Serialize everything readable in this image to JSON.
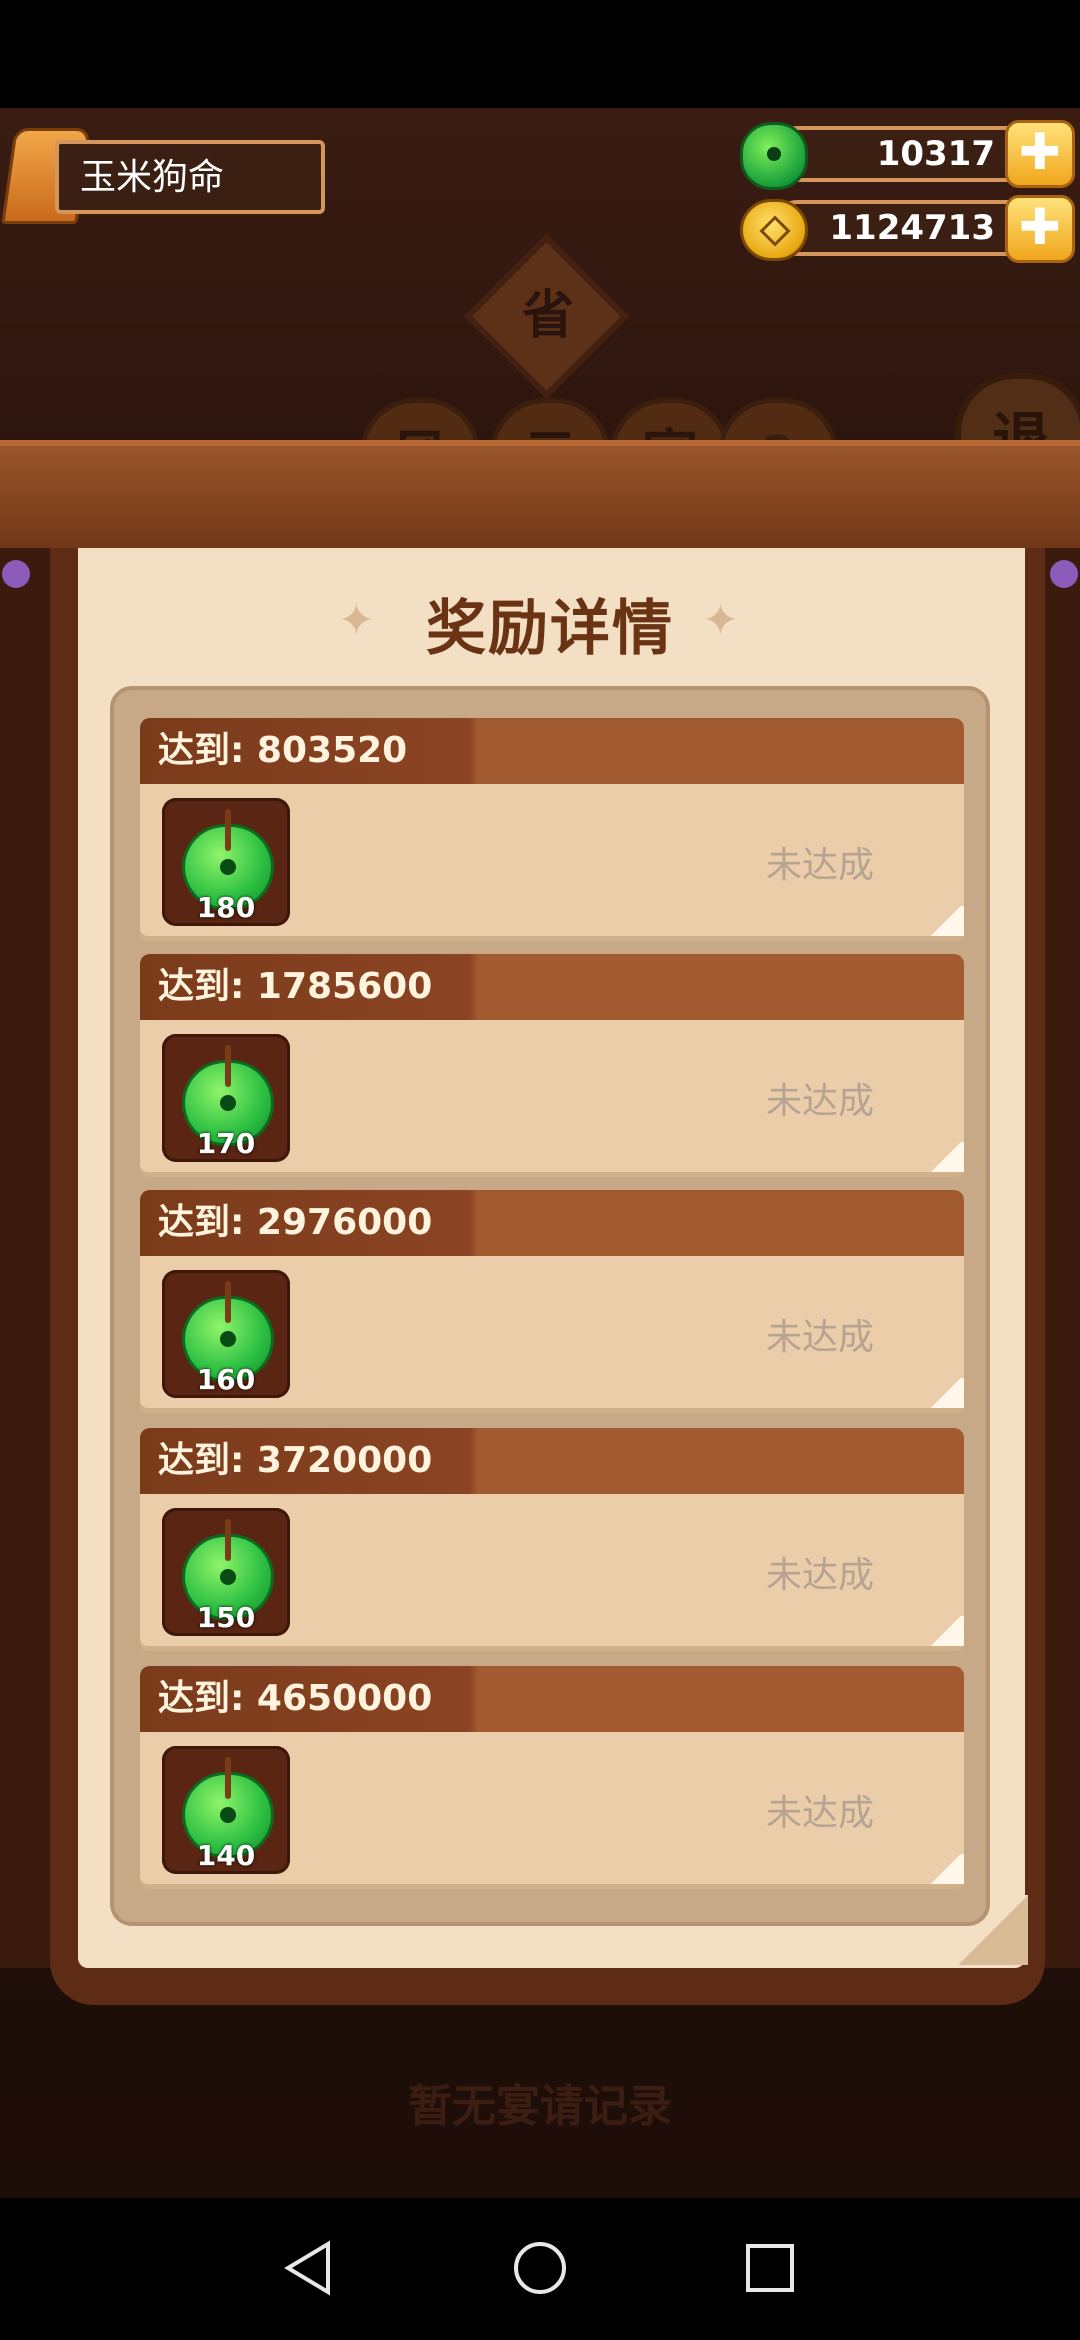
{
  "header": {
    "player_name": "玉米狗命",
    "jade_currency": "10317",
    "coin_currency": "1124713",
    "plus_symbol": "✚"
  },
  "background": {
    "emblem": "省",
    "round_buttons": [
      "风",
      "云",
      "宴"
    ],
    "help_symbol": "?",
    "exit_label": "退",
    "empty_record_text": "暂无宴请记录"
  },
  "panel": {
    "title": "奖励详情",
    "rows": [
      {
        "target_label": "达到: 803520",
        "reward_count": "180",
        "status": "未达成"
      },
      {
        "target_label": "达到: 1785600",
        "reward_count": "170",
        "status": "未达成"
      },
      {
        "target_label": "达到: 2976000",
        "reward_count": "160",
        "status": "未达成"
      },
      {
        "target_label": "达到: 3720000",
        "reward_count": "150",
        "status": "未达成"
      },
      {
        "target_label": "达到: 4650000",
        "reward_count": "140",
        "status": "未达成"
      }
    ]
  },
  "icons": {
    "reward": "jade-icon",
    "jade_currency": "jade-icon",
    "coin_currency": "coin-icon",
    "nav": [
      "back-icon",
      "home-icon",
      "recents-icon"
    ]
  }
}
